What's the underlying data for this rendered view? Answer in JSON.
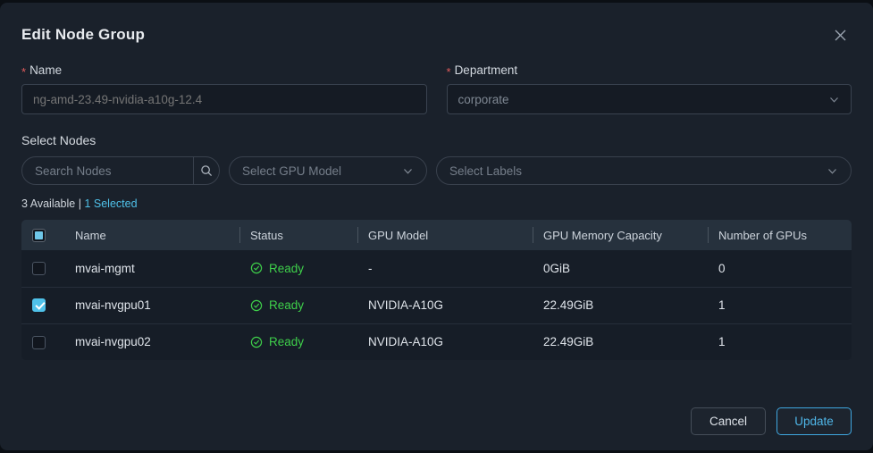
{
  "dialog": {
    "title": "Edit Node Group",
    "close_icon": "close-icon"
  },
  "form": {
    "name": {
      "label": "Name",
      "required_marker": "*",
      "value": "",
      "placeholder": "ng-amd-23.49-nvidia-a10g-12.4"
    },
    "department": {
      "label": "Department",
      "required_marker": "*",
      "value": "corporate",
      "chevron_icon": "chevron-down-icon"
    }
  },
  "select_nodes": {
    "title": "Select Nodes",
    "search": {
      "placeholder": "Search Nodes",
      "value": "",
      "icon": "search-icon"
    },
    "gpu_model_filter": {
      "value": "Select GPU Model",
      "chevron_icon": "chevron-down-icon"
    },
    "labels_filter": {
      "value": "Select Labels",
      "chevron_icon": "chevron-down-icon"
    },
    "counts": {
      "available": "3 Available",
      "divider": "|",
      "selected": "1 Selected",
      "selected_color": "#4fc1e9"
    },
    "table": {
      "header_checkbox_state": "indeterminate",
      "columns": [
        "Name",
        "Status",
        "GPU Model",
        "GPU Memory Capacity",
        "Number of GPUs"
      ],
      "rows": [
        {
          "checked": false,
          "name": "mvai-mgmt",
          "status": "Ready",
          "status_icon": "check-circle-icon",
          "status_color": "#3ecf4a",
          "gpu_model": "-",
          "gpu_memory": "0GiB",
          "gpu_count": "0"
        },
        {
          "checked": true,
          "name": "mvai-nvgpu01",
          "status": "Ready",
          "status_icon": "check-circle-icon",
          "status_color": "#3ecf4a",
          "gpu_model": "NVIDIA-A10G",
          "gpu_memory": "22.49GiB",
          "gpu_count": "1"
        },
        {
          "checked": false,
          "name": "mvai-nvgpu02",
          "status": "Ready",
          "status_icon": "check-circle-icon",
          "status_color": "#3ecf4a",
          "gpu_model": "NVIDIA-A10G",
          "gpu_memory": "22.49GiB",
          "gpu_count": "1"
        }
      ]
    }
  },
  "footer": {
    "cancel_label": "Cancel",
    "update_label": "Update"
  }
}
